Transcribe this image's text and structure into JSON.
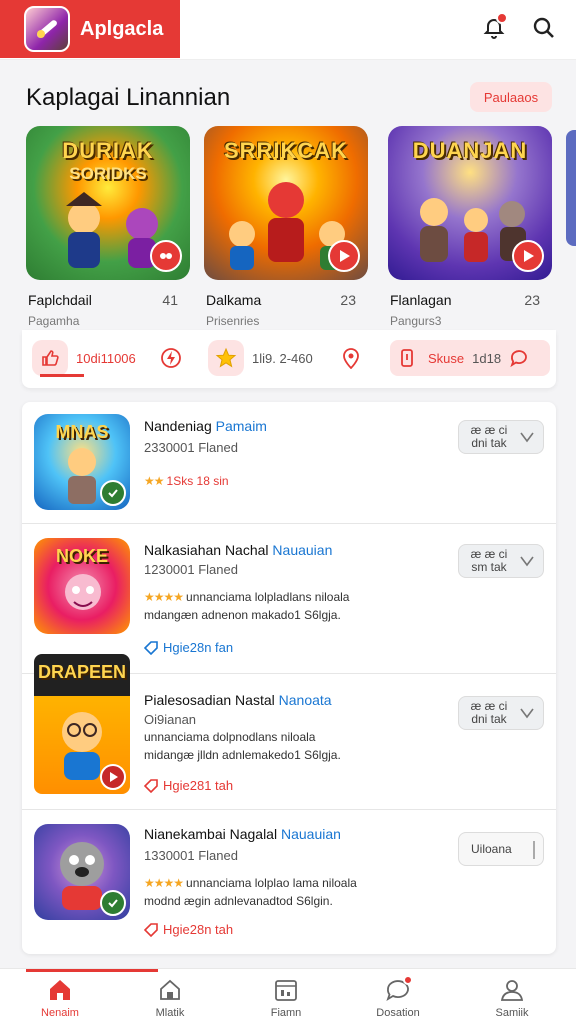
{
  "app": {
    "title": "Aplgacla"
  },
  "section": {
    "title": "Kaplagai Linannian",
    "pill": "Paulaaos"
  },
  "featured": [
    {
      "art_line1": "DURIAK",
      "art_line2": "SORIDKS",
      "name": "Faplchdail",
      "count": "41",
      "sub": "Pagamha"
    },
    {
      "art_line1": "SRRIKCAK",
      "art_line2": "",
      "name": "Dalkama",
      "count": "23",
      "sub": "Prisenries"
    },
    {
      "art_line1": "DUANJAN",
      "art_line2": "",
      "name": "Flanlagan",
      "count": "23",
      "sub": "Pangurs3"
    }
  ],
  "actions": [
    {
      "label": "10di11006"
    },
    {
      "label": "1li9. 2-460"
    },
    {
      "label": "Skuse",
      "extra": "1d18"
    }
  ],
  "list": [
    {
      "thumb_label": "MNAS",
      "title": "Nandeniag",
      "title_accent": "Pamaim",
      "meta": "2330001  Flaned",
      "stars_text": "1Sks 18 sin",
      "btn_lines": [
        "æ æ ci",
        "dni tak"
      ]
    },
    {
      "thumb_label": "NOKE",
      "title": "Nalkasiahan Nachal",
      "title_accent": "Nauauian",
      "meta": "1230001  Flaned",
      "stars_text": "unnanciama lolpladlans niloala",
      "desc2": "mdangæn adnenon makado1 S6lgja.",
      "tag": "Hgie28n fan",
      "btn_lines": [
        "æ æ ci",
        "sm tak"
      ]
    },
    {
      "thumb_label": "DRAPEEN",
      "title": "Pialesosadian Nastal",
      "title_accent": "Nanoata",
      "meta": "Oi9ianan",
      "stars_text": "unnanciama dolpnodlans niloala",
      "desc2": "midangæ jlldn adnlemakedo1 S6lgja.",
      "tag": "Hgie281 tah",
      "btn_lines": [
        "æ æ ci",
        "dni tak"
      ]
    },
    {
      "thumb_label": "",
      "title": "Nianekambai Nagalal",
      "title_accent": "Nauauian",
      "meta": "1330001  Flaned",
      "stars_text": "unnanciama lolplao lama niloala",
      "desc2": "modnd ægin adnlevanadtod S6lgin.",
      "tag": "Hgie28n tah",
      "btn_plain": "Uiloana"
    }
  ],
  "bottom_nav": [
    {
      "label": "Nenaim",
      "icon": "home-icon",
      "active": true
    },
    {
      "label": "Mlatik",
      "icon": "store-icon",
      "active": false
    },
    {
      "label": "Fiamn",
      "icon": "calendar-icon",
      "active": false
    },
    {
      "label": "Dosation",
      "icon": "chat-icon",
      "active": false
    },
    {
      "label": "Samiik",
      "icon": "profile-icon",
      "active": false
    }
  ],
  "colors": {
    "accent": "#e53935",
    "link": "#1976d2",
    "star": "#f5a623"
  }
}
